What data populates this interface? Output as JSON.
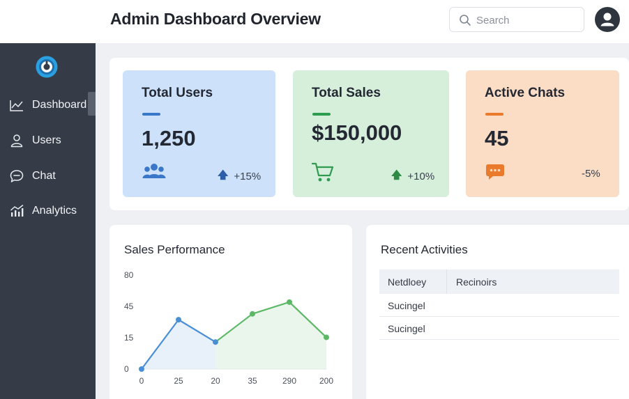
{
  "header": {
    "title": "Admin Dashboard Overview",
    "search_placeholder": "Search",
    "search_icon": "search-icon",
    "avatar_icon": "user-avatar-icon"
  },
  "sidebar": {
    "logo": "app-logo",
    "items": [
      {
        "label": "Dashboard",
        "icon": "line-chart-icon",
        "active": true
      },
      {
        "label": "Users",
        "icon": "user-icon",
        "active": false
      },
      {
        "label": "Chat",
        "icon": "chat-bubble-icon",
        "active": false
      },
      {
        "label": "Analytics",
        "icon": "bar-chart-icon",
        "active": false
      }
    ]
  },
  "stats": [
    {
      "title": "Total Users",
      "value": "1,250",
      "change": "+15%",
      "direction": "up",
      "icon": "users-group-icon",
      "color": "#cde2fa",
      "accent": "#3a77c9"
    },
    {
      "title": "Total Sales",
      "value": "$150,000",
      "change": "+10%",
      "direction": "up",
      "icon": "shopping-cart-icon",
      "color": "#d6efdb",
      "accent": "#2e9c4f"
    },
    {
      "title": "Active Chats",
      "value": "45",
      "change": "-5%",
      "direction": "none",
      "icon": "chat-dots-icon",
      "color": "#fbdcc5",
      "accent": "#ea7a2c"
    }
  ],
  "sales_chart": {
    "title": "Sales Performance"
  },
  "chart_data": {
    "type": "line",
    "title": "Sales Performance",
    "y_ticks": [
      "80",
      "45",
      "15",
      "0"
    ],
    "x_ticks": [
      "0",
      "25",
      "20",
      "35",
      "290",
      "200"
    ],
    "values": [
      0,
      42,
      23,
      47,
      57,
      27
    ],
    "ylim": [
      0,
      80
    ],
    "grid": false,
    "legend": "none",
    "colors": [
      "#4a8fd6",
      "#5cb866"
    ]
  },
  "activities": {
    "title": "Recent Activities",
    "columns": [
      "Netdloey",
      "Recinoirs"
    ],
    "rows": [
      "Sucingel",
      "Sucingel"
    ]
  }
}
